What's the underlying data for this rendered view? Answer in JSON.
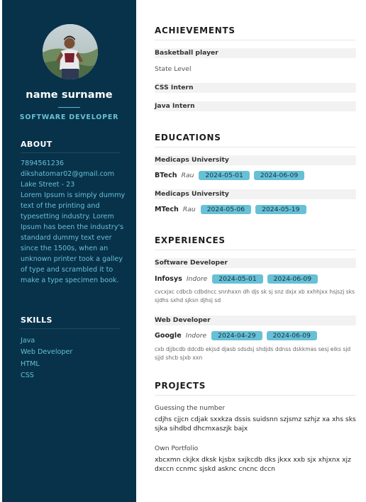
{
  "profile": {
    "name": "name surname",
    "role": "SOFTWARE DEVELOPER"
  },
  "about": {
    "heading": "ABOUT",
    "phone": "7894561236",
    "email": "dikshatomar02@gmail.com",
    "address": "Lake Street - 23",
    "bio": "Lorem Ipsum is simply dummy text of the printing and typesetting industry. Lorem Ipsum has been the industry's standard dummy text ever since the 1500s, when an unknown printer took a galley of type and scrambled it to make a type specimen book."
  },
  "skills": {
    "heading": "SKILLS",
    "items": [
      "Java",
      "Web Developer",
      "HTML",
      "CSS"
    ]
  },
  "achievements": {
    "heading": "ACHIEVEMENTS",
    "items": [
      {
        "title": "Basketball player",
        "detail": "State Level"
      },
      {
        "title": "CSS Intern",
        "detail": ""
      },
      {
        "title": "Java Intern",
        "detail": ""
      }
    ]
  },
  "educations": {
    "heading": "EDUCATIONS",
    "items": [
      {
        "institution": "Medicaps University",
        "degree": "BTech",
        "location": "Rau",
        "start": "2024-05-01",
        "end": "2024-06-09"
      },
      {
        "institution": "Medicaps University",
        "degree": "MTech",
        "location": "Rau",
        "start": "2024-05-06",
        "end": "2024-05-19"
      }
    ]
  },
  "experiences": {
    "heading": "EXPERIENCES",
    "items": [
      {
        "title": "Software Developer",
        "company": "Infosys",
        "location": "Indore",
        "start": "2024-05-01",
        "end": "2024-06-09",
        "description": "cvcxjxc cdbcb cdbdncc snnhxxn dh djs sk sj snz dxjx xb xxhhjxx hsjszj sks sjdhs sxhd sjksn djhsj sd"
      },
      {
        "title": "Web Developer",
        "company": "Google",
        "location": "Indore",
        "start": "2024-04-29",
        "end": "2024-06-09",
        "description": "cxb djjbcdb ddcdb ekjsd djasb sdsdsj shdjds ddnss dskkmas sesj eiks sjd sjjd shcb sjxb xxn"
      }
    ]
  },
  "projects": {
    "heading": "PROJECTS",
    "items": [
      {
        "name": "Guessing the number",
        "description": "cdjhs cjjcn cdjak sxxkza dssis suidsnn szjsmz szhjz xa xhs sks sjka sihdbd dhcmxaszjk bajx"
      },
      {
        "name": "Own Portfolio",
        "description": "xbcxmn ckjkx dksk kjsbx sxjkcdb dks jkxx xxb sjx xhjxnx xjz dxccn ccnmc sjskd asknc cncnc dccn"
      }
    ]
  },
  "colors": {
    "sidebar": "#07324a",
    "accent": "#67c0d6"
  },
  "icons": [
    "profile-photo"
  ]
}
